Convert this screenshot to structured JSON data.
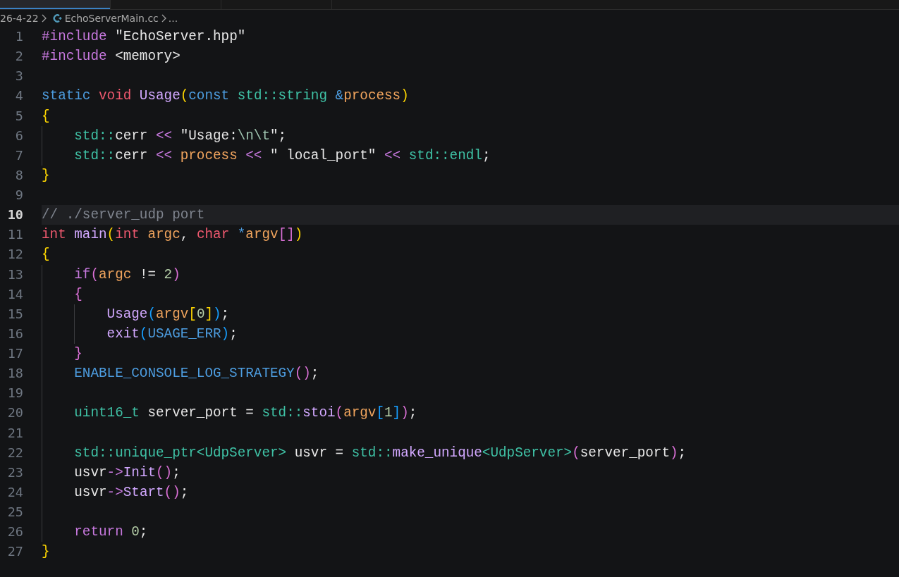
{
  "tabs": [
    {
      "selected": true
    },
    {
      "selected": false
    },
    {
      "selected": false
    }
  ],
  "breadcrumb": {
    "folder": "26-4-22",
    "file": "EchoServerMain.cc",
    "more": "..."
  },
  "lines": [
    {
      "number": "1",
      "current": false,
      "tokens": [
        {
          "text": "#include ",
          "kind": "kw"
        },
        {
          "text": "\"EchoServer.hpp\"",
          "kind": "str"
        }
      ]
    },
    {
      "number": "2",
      "current": false,
      "tokens": [
        {
          "text": "#include ",
          "kind": "kw"
        },
        {
          "text": "<memory>",
          "kind": "str"
        }
      ]
    },
    {
      "number": "3",
      "current": false
    },
    {
      "number": "4",
      "current": false,
      "tokens": [
        {
          "text": "static ",
          "kind": "st"
        },
        {
          "text": "void ",
          "kind": "ty"
        },
        {
          "text": "Usage",
          "kind": "fn"
        },
        {
          "text": "(",
          "kind": "b1"
        },
        {
          "text": "const ",
          "kind": "st"
        },
        {
          "text": "std::string ",
          "kind": "ns"
        },
        {
          "text": "&",
          "kind": "st"
        },
        {
          "text": "process",
          "kind": "var"
        },
        {
          "text": ")",
          "kind": "b1"
        }
      ]
    },
    {
      "number": "5",
      "current": false,
      "tokens": [
        {
          "text": "{",
          "kind": "b1"
        }
      ]
    },
    {
      "number": "6",
      "current": false,
      "tokens": [
        {
          "text": "    std::",
          "kind": "ns"
        },
        {
          "text": "cerr ",
          "kind": "pl"
        },
        {
          "text": "<< ",
          "kind": "kw"
        },
        {
          "text": "\"Usage:",
          "kind": "str"
        },
        {
          "text": "\\n\\t",
          "kind": "esc"
        },
        {
          "text": "\"",
          "kind": "str"
        },
        {
          "text": ";",
          "kind": "pl"
        }
      ]
    },
    {
      "number": "7",
      "current": false,
      "tokens": [
        {
          "text": "    std::",
          "kind": "ns"
        },
        {
          "text": "cerr ",
          "kind": "pl"
        },
        {
          "text": "<< ",
          "kind": "kw"
        },
        {
          "text": "process ",
          "kind": "var"
        },
        {
          "text": "<< ",
          "kind": "kw"
        },
        {
          "text": "\" local_port\" ",
          "kind": "str"
        },
        {
          "text": "<< ",
          "kind": "kw"
        },
        {
          "text": "std::endl",
          "kind": "ns"
        },
        {
          "text": ";",
          "kind": "pl"
        }
      ]
    },
    {
      "number": "8",
      "current": false,
      "tokens": [
        {
          "text": "}",
          "kind": "b1"
        }
      ]
    },
    {
      "number": "9",
      "current": false
    },
    {
      "number": "10",
      "current": true,
      "tokens": [
        {
          "text": "// ./server_udp port",
          "kind": "cm"
        }
      ]
    },
    {
      "number": "11",
      "current": false,
      "tokens": [
        {
          "text": "int ",
          "kind": "ty"
        },
        {
          "text": "main",
          "kind": "fn"
        },
        {
          "text": "(",
          "kind": "b1"
        },
        {
          "text": "int ",
          "kind": "ty"
        },
        {
          "text": "argc",
          "kind": "var"
        },
        {
          "text": ", ",
          "kind": "pl"
        },
        {
          "text": "char ",
          "kind": "ty"
        },
        {
          "text": "*",
          "kind": "st"
        },
        {
          "text": "argv",
          "kind": "var"
        },
        {
          "text": "[]",
          "kind": "b2"
        },
        {
          "text": ")",
          "kind": "b1"
        }
      ]
    },
    {
      "number": "12",
      "current": false,
      "tokens": [
        {
          "text": "{",
          "kind": "b1"
        }
      ]
    },
    {
      "number": "13",
      "current": false,
      "tokens": [
        {
          "text": "    if",
          "kind": "kw"
        },
        {
          "text": "(",
          "kind": "b2"
        },
        {
          "text": "argc",
          "kind": "var"
        },
        {
          "text": " != ",
          "kind": "pl"
        },
        {
          "text": "2",
          "kind": "num"
        },
        {
          "text": ")",
          "kind": "b2"
        }
      ]
    },
    {
      "number": "14",
      "current": false,
      "tokens": [
        {
          "text": "    {",
          "kind": "b2"
        }
      ]
    },
    {
      "number": "15",
      "current": false,
      "tokens": [
        {
          "text": "        Usage",
          "kind": "fn"
        },
        {
          "text": "(",
          "kind": "b3"
        },
        {
          "text": "argv",
          "kind": "var"
        },
        {
          "text": "[",
          "kind": "b1"
        },
        {
          "text": "0",
          "kind": "num"
        },
        {
          "text": "]",
          "kind": "b1"
        },
        {
          "text": ")",
          "kind": "b3"
        },
        {
          "text": ";",
          "kind": "pl"
        }
      ]
    },
    {
      "number": "16",
      "current": false,
      "tokens": [
        {
          "text": "        exit",
          "kind": "fn"
        },
        {
          "text": "(",
          "kind": "b3"
        },
        {
          "text": "USAGE_ERR",
          "kind": "mac"
        },
        {
          "text": ")",
          "kind": "b3"
        },
        {
          "text": ";",
          "kind": "pl"
        }
      ]
    },
    {
      "number": "17",
      "current": false,
      "tokens": [
        {
          "text": "    }",
          "kind": "b2"
        }
      ]
    },
    {
      "number": "18",
      "current": false,
      "tokens": [
        {
          "text": "    ENABLE_CONSOLE_LOG_STRATEGY",
          "kind": "mac"
        },
        {
          "text": "()",
          "kind": "b2"
        },
        {
          "text": ";",
          "kind": "pl"
        }
      ]
    },
    {
      "number": "19",
      "current": false
    },
    {
      "number": "20",
      "current": false,
      "tokens": [
        {
          "text": "    uint16_t",
          "kind": "ns"
        },
        {
          "text": " server_port = ",
          "kind": "pl"
        },
        {
          "text": "std::",
          "kind": "ns"
        },
        {
          "text": "stoi",
          "kind": "fn"
        },
        {
          "text": "(",
          "kind": "b2"
        },
        {
          "text": "argv",
          "kind": "var"
        },
        {
          "text": "[",
          "kind": "b3"
        },
        {
          "text": "1",
          "kind": "num"
        },
        {
          "text": "]",
          "kind": "b3"
        },
        {
          "text": ")",
          "kind": "b2"
        },
        {
          "text": ";",
          "kind": "pl"
        }
      ]
    },
    {
      "number": "21",
      "current": false
    },
    {
      "number": "22",
      "current": false,
      "tokens": [
        {
          "text": "    std::unique_ptr<UdpServer>",
          "kind": "ns"
        },
        {
          "text": " usvr = ",
          "kind": "pl"
        },
        {
          "text": "std::",
          "kind": "ns"
        },
        {
          "text": "make_unique",
          "kind": "fn"
        },
        {
          "text": "<UdpServer>",
          "kind": "ns"
        },
        {
          "text": "(",
          "kind": "b2"
        },
        {
          "text": "server_port",
          "kind": "pl"
        },
        {
          "text": ")",
          "kind": "b2"
        },
        {
          "text": ";",
          "kind": "pl"
        }
      ]
    },
    {
      "number": "23",
      "current": false,
      "tokens": [
        {
          "text": "    usvr",
          "kind": "pl"
        },
        {
          "text": "->",
          "kind": "kw"
        },
        {
          "text": "Init",
          "kind": "fn"
        },
        {
          "text": "()",
          "kind": "b2"
        },
        {
          "text": ";",
          "kind": "pl"
        }
      ]
    },
    {
      "number": "24",
      "current": false,
      "tokens": [
        {
          "text": "    usvr",
          "kind": "pl"
        },
        {
          "text": "->",
          "kind": "kw"
        },
        {
          "text": "Start",
          "kind": "fn"
        },
        {
          "text": "()",
          "kind": "b2"
        },
        {
          "text": ";",
          "kind": "pl"
        }
      ]
    },
    {
      "number": "25",
      "current": false
    },
    {
      "number": "26",
      "current": false,
      "tokens": [
        {
          "text": "    return ",
          "kind": "kw"
        },
        {
          "text": "0",
          "kind": "num"
        },
        {
          "text": ";",
          "kind": "pl"
        }
      ]
    },
    {
      "number": "27",
      "current": false,
      "tokens": [
        {
          "text": "}",
          "kind": "b1"
        }
      ]
    }
  ]
}
